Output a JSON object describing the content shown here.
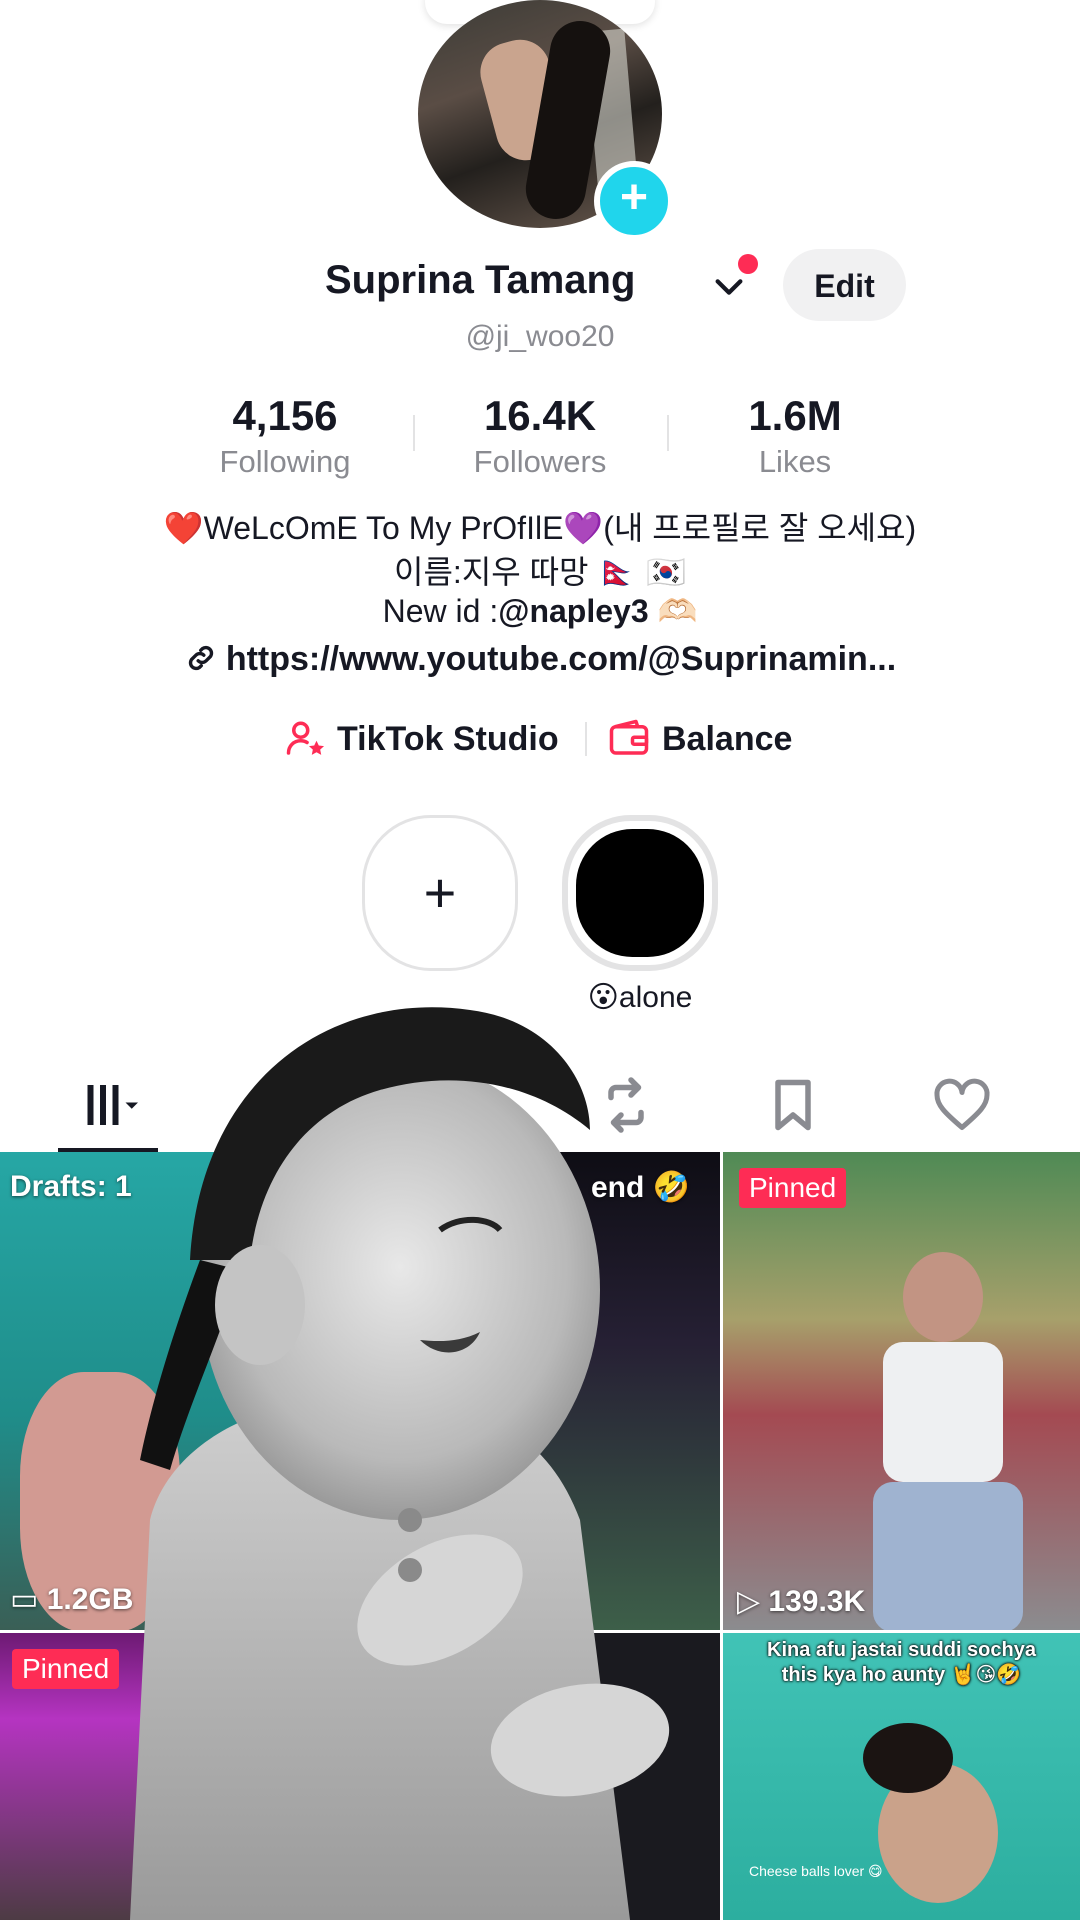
{
  "profile": {
    "name": "Suprina Tamang",
    "name_badge": "",
    "handle": "@ji_woo20",
    "edit_label": "Edit"
  },
  "stats": [
    {
      "value": "4,156",
      "label": "Following"
    },
    {
      "value": "16.4K",
      "label": "Followers"
    },
    {
      "value": "1.6M",
      "label": "Likes"
    }
  ],
  "bio": {
    "line1": "❤️WeLcOmE To My PrOfIlE💜(내 프로필로 잘 오세요)",
    "line2": "이름:지우  따망 🇳🇵 🇰🇷",
    "line3_prefix": "New id :",
    "line3_id": "@napley3",
    "line3_emoji": "🫶🏻",
    "link": "https://www.youtube.com/@Suprinamin..."
  },
  "tools": {
    "studio_label": "TikTok Studio",
    "balance_label": "Balance"
  },
  "stories": {
    "add_label": "+",
    "highlight_label": "😮alone"
  },
  "grid": {
    "drafts_label": "Drafts: 1",
    "drafts_size": "1.2GB",
    "mid_caption": "end 🤣",
    "pinned_label": "Pinned",
    "right_views": "139.3K",
    "bottom_pinned_label": "Pinned",
    "b3_caption_line1": "Kina afu jastai suddi sochya",
    "b3_caption_line2": "this kya ho aunty 🤘😘🤣",
    "b3_caption_small": "Cheese balls lover 😋"
  },
  "colors": {
    "accent": "#fe2c55",
    "add_blue": "#20d5ec",
    "muted": "#8a8b91"
  }
}
